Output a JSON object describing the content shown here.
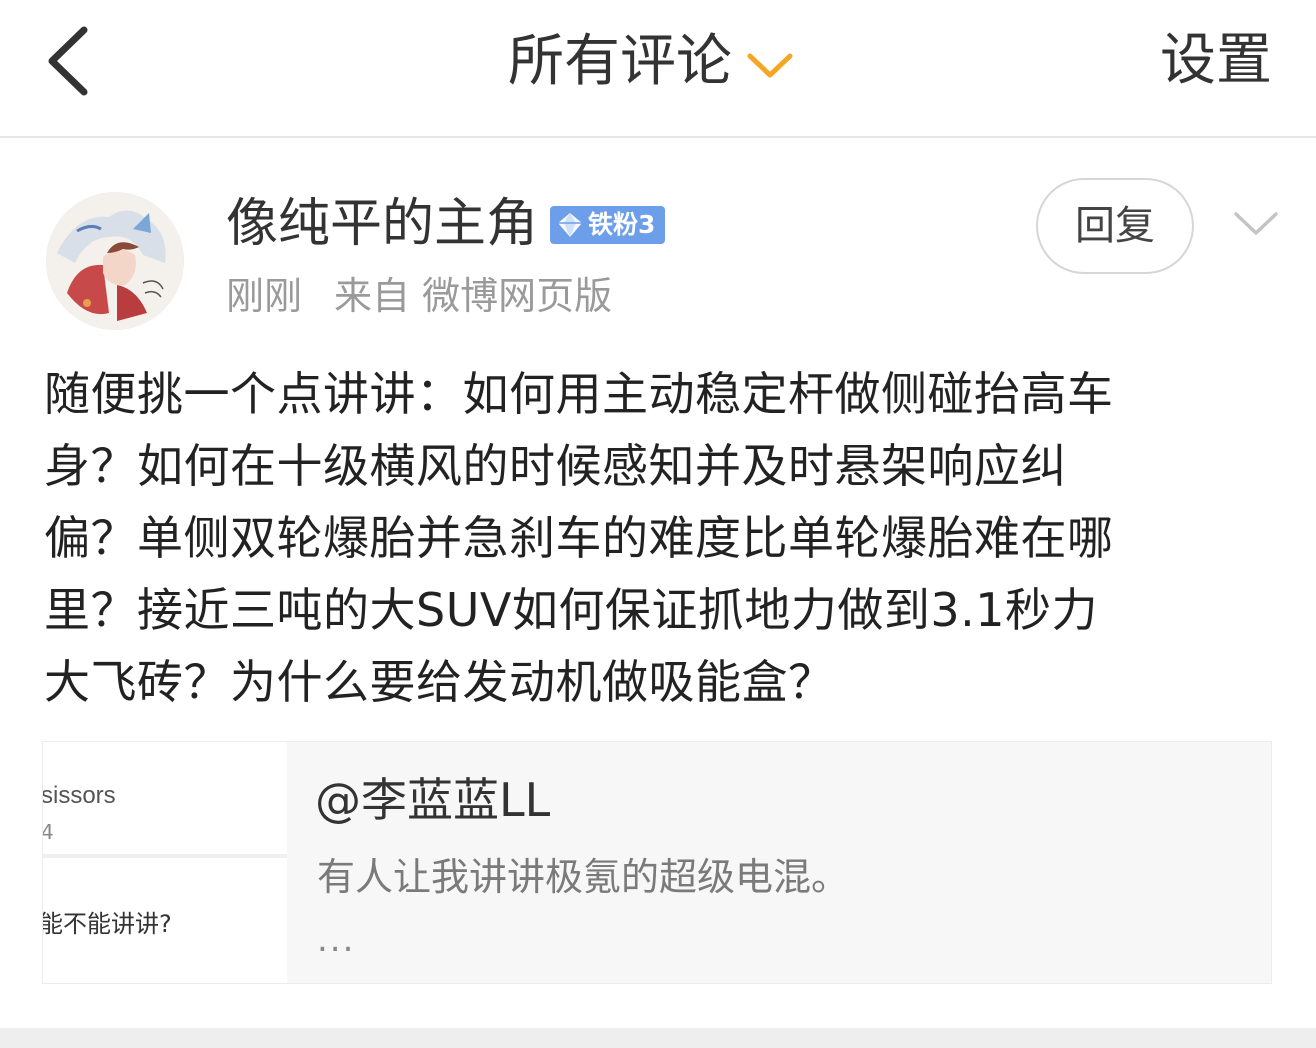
{
  "header": {
    "title": "所有评论",
    "settings_label": "设置"
  },
  "comment": {
    "username": "像纯平的主角",
    "badge": "铁粉3",
    "time": "刚刚",
    "source": "来自 微博网页版",
    "reply_label": "回复",
    "body": "随便挑一个点讲讲：如何用主动稳定杆做侧碰抬高车\n身？如何在十级横风的时候感知并及时悬架响应纠\n偏？单侧双轮爆胎并急刹车的难度比单轮爆胎难在哪\n里？接近三吨的大SUV如何保证抓地力做到3.1秒力\n大飞砖？为什么要给发动机做吸能盒？"
  },
  "quote": {
    "user": "@李蓝蓝LL",
    "text": "有人让我讲讲极氪的超级电混。",
    "ellipsis": "...",
    "thumb_text_1": "sissors",
    "thumb_text_2": "4",
    "thumb_text_3": "能不能讲讲?"
  },
  "colors": {
    "accent_orange": "#f5a623",
    "badge_blue": "#6c9ee9",
    "meta_gray": "#9a9a9a"
  },
  "icons": {
    "back": "chevron-left-icon",
    "title_dropdown": "chevron-down-icon",
    "more": "chevron-down-icon",
    "badge": "diamond-icon"
  }
}
